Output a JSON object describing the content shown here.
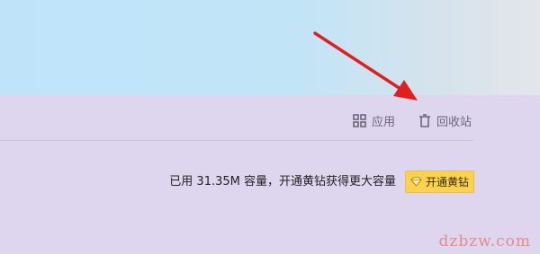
{
  "toolbar": {
    "apps": {
      "label": "应用",
      "icon": "grid-icon"
    },
    "recycle_bin": {
      "label": "回收站",
      "icon": "trash-icon"
    }
  },
  "storage": {
    "usage_text": "已用 31.35M 容量，开通黄钻获得更大容量",
    "upgrade_button": {
      "label": "开通黄钻",
      "icon": "diamond-icon"
    }
  },
  "watermark": "dzbzw.com",
  "colors": {
    "banner": "#c1e4f8",
    "background": "#ded5ee",
    "toolbar_text": "#6c6878",
    "vip_button": "#fbd24e",
    "annotation_arrow": "#e02020",
    "watermark": "#e88a8a"
  }
}
